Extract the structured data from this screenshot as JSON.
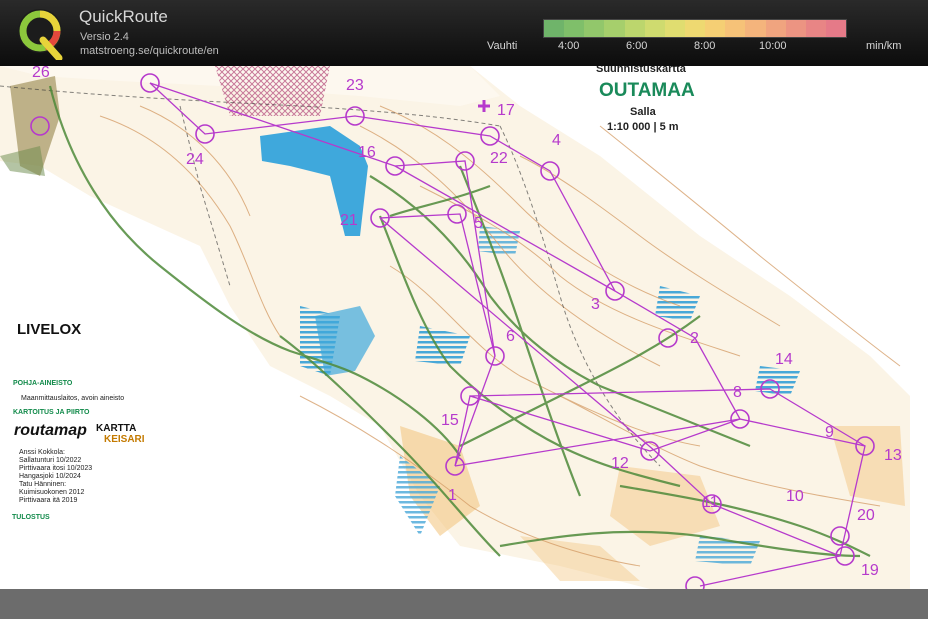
{
  "app": {
    "title": "QuickRoute",
    "version": "Versio 2.4",
    "url": "matstroeng.se/quickroute/en"
  },
  "pace_scale": {
    "label": "Vauhti",
    "ticks": [
      "4:00",
      "6:00",
      "8:00",
      "10:00"
    ],
    "unit": "min/km",
    "colors": [
      "#6fb46a",
      "#7fbf6a",
      "#92c76b",
      "#a6cf6c",
      "#bcd66d",
      "#cfdb6f",
      "#e0dd70",
      "#eed971",
      "#f5cf74",
      "#f6c278",
      "#f4b47c",
      "#f0a47f",
      "#ec9482",
      "#e88585",
      "#e57a88"
    ]
  },
  "map": {
    "type_label": "Suunnistuskartta",
    "name": "OUTAMAA",
    "area": "Salla",
    "scale": "1:10 000 | 5 m",
    "livelox": "LIVELOX",
    "credits": {
      "pohja_title": "POHJA-AINEISTO",
      "pohja_text": "Maanmittauslaitos, avoin aineisto",
      "kartoitus_title": "KARTOITUS JA PIIRTO",
      "routamap": "routamap",
      "kartta": "KARTTA",
      "keisari": "KEISARI",
      "lines": [
        "Anssi Kokkola:",
        "Sallatunturi 10/2022",
        "Pirttivaara itosi 10/2023",
        "Hangasjoki 10/2024",
        "Tatu Hänninen:",
        "Kuimisuokonen 2012",
        "Pirttivaara itä 2019"
      ],
      "tulostus": "TULOSTUS"
    },
    "controls": [
      {
        "label": "1"
      },
      {
        "label": "2"
      },
      {
        "label": "3"
      },
      {
        "label": "4"
      },
      {
        "label": "5"
      },
      {
        "label": "6"
      },
      {
        "label": "8"
      },
      {
        "label": "9"
      },
      {
        "label": "10"
      },
      {
        "label": "11"
      },
      {
        "label": "12"
      },
      {
        "label": "13"
      },
      {
        "label": "14"
      },
      {
        "label": "15"
      },
      {
        "label": "16"
      },
      {
        "label": "17"
      },
      {
        "label": "18"
      },
      {
        "label": "19"
      },
      {
        "label": "20"
      },
      {
        "label": "21"
      },
      {
        "label": "22"
      },
      {
        "label": "23"
      },
      {
        "label": "24"
      },
      {
        "label": "26"
      }
    ],
    "colors": {
      "course": "#b63acc",
      "route": "#4e8a3a",
      "water": "#3fa8dc",
      "contour": "#d39a63",
      "open_land": "#f2c27a"
    }
  }
}
